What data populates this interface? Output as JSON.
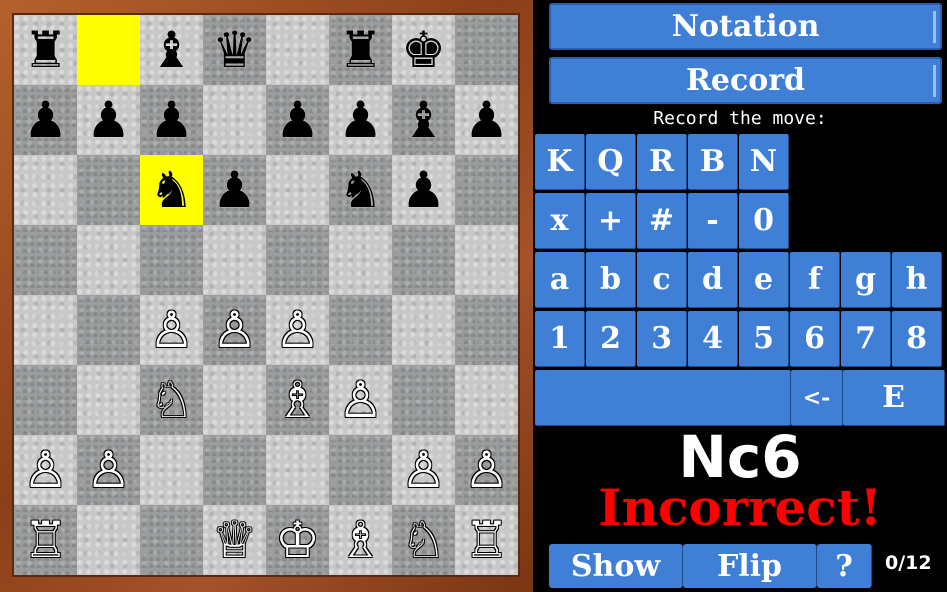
{
  "board": {
    "ranks": [
      [
        [
          "r",
          "b"
        ],
        [
          "",
          ""
        ],
        [
          "b",
          "b"
        ],
        [
          "q",
          "b"
        ],
        [
          "",
          ""
        ],
        [
          "r",
          "b"
        ],
        [
          "k",
          "b"
        ],
        [
          "",
          ""
        ]
      ],
      [
        [
          "p",
          "b"
        ],
        [
          "p",
          "b"
        ],
        [
          "p",
          "b"
        ],
        [
          "",
          ""
        ],
        [
          "p",
          "b"
        ],
        [
          "p",
          "b"
        ],
        [
          "b",
          "b"
        ],
        [
          "p",
          "b"
        ]
      ],
      [
        [
          "",
          ""
        ],
        [
          "",
          ""
        ],
        [
          "n",
          "b"
        ],
        [
          "p",
          "b"
        ],
        [
          "",
          ""
        ],
        [
          "n",
          "b"
        ],
        [
          "p",
          "b"
        ],
        [
          "",
          ""
        ]
      ],
      [
        [
          "",
          ""
        ],
        [
          "",
          ""
        ],
        [
          "",
          ""
        ],
        [
          "",
          ""
        ],
        [
          "",
          ""
        ],
        [
          "",
          ""
        ],
        [
          "",
          ""
        ],
        [
          "",
          ""
        ]
      ],
      [
        [
          "",
          ""
        ],
        [
          "",
          ""
        ],
        [
          "p",
          "w"
        ],
        [
          "p",
          "w"
        ],
        [
          "p",
          "w"
        ],
        [
          "",
          ""
        ],
        [
          "",
          ""
        ],
        [
          "",
          ""
        ]
      ],
      [
        [
          "",
          ""
        ],
        [
          "",
          ""
        ],
        [
          "n",
          "w"
        ],
        [
          "",
          ""
        ],
        [
          "b",
          "w"
        ],
        [
          "p",
          "w"
        ],
        [
          "",
          ""
        ],
        [
          "",
          ""
        ]
      ],
      [
        [
          "p",
          "w"
        ],
        [
          "p",
          "w"
        ],
        [
          "",
          ""
        ],
        [
          "",
          ""
        ],
        [
          "",
          ""
        ],
        [
          "",
          ""
        ],
        [
          "p",
          "w"
        ],
        [
          "p",
          "w"
        ]
      ],
      [
        [
          "r",
          "w"
        ],
        [
          "",
          ""
        ],
        [
          "",
          ""
        ],
        [
          "q",
          "w"
        ],
        [
          "k",
          "w"
        ],
        [
          "b",
          "w"
        ],
        [
          "n",
          "w"
        ],
        [
          "r",
          "w"
        ]
      ]
    ],
    "highlighted": [
      [
        0,
        1
      ],
      [
        2,
        2
      ]
    ],
    "colors": {
      "light": "#c8c8c8",
      "dark": "#9a9c9e",
      "highlight": "#ffff00"
    }
  },
  "menu": {
    "notation_label": "Notation",
    "record_label": "Record"
  },
  "prompt": "Record the move:",
  "keypad": {
    "row1": [
      "K",
      "Q",
      "R",
      "B",
      "N"
    ],
    "row2": [
      "x",
      "+",
      "#",
      "-",
      "0"
    ],
    "row3": [
      "a",
      "b",
      "c",
      "d",
      "e",
      "f",
      "g",
      "h"
    ],
    "row4": [
      "1",
      "2",
      "3",
      "4",
      "5",
      "6",
      "7",
      "8"
    ],
    "backspace": "<-",
    "enter": "E"
  },
  "entered_move": "Nc6",
  "verdict": "Incorrect!",
  "controls": {
    "show": "Show",
    "flip": "Flip",
    "help": "?"
  },
  "progress": "0/12",
  "accent_color": "#3f7fd6"
}
